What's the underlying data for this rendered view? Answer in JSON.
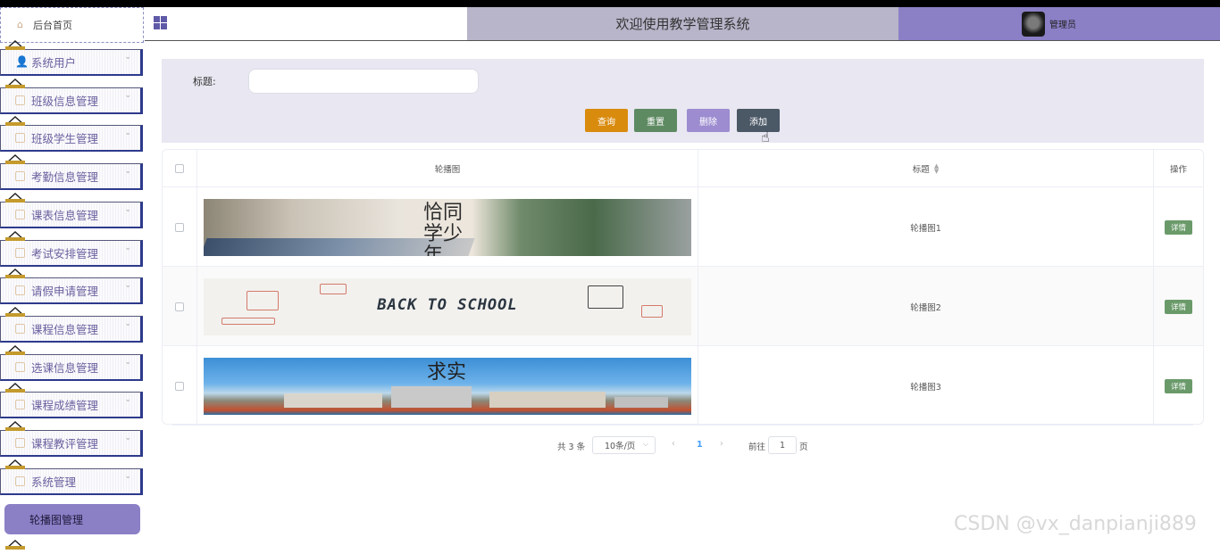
{
  "header": {
    "title": "欢迎使用教学管理系统",
    "user": "管理员"
  },
  "sidebar": {
    "home": "后台首页",
    "items": [
      {
        "label": "系统用户"
      },
      {
        "label": "班级信息管理"
      },
      {
        "label": "班级学生管理"
      },
      {
        "label": "考勤信息管理"
      },
      {
        "label": "课表信息管理"
      },
      {
        "label": "考试安排管理"
      },
      {
        "label": "请假申请管理"
      },
      {
        "label": "课程信息管理"
      },
      {
        "label": "选课信息管理"
      },
      {
        "label": "课程成绩管理"
      },
      {
        "label": "课程教评管理"
      },
      {
        "label": "系统管理"
      }
    ],
    "active_sub": "轮播图管理"
  },
  "search": {
    "label": "标题:",
    "placeholder": "",
    "buttons": {
      "query": "查询",
      "reset": "重置",
      "delete": "删除",
      "add": "添加"
    }
  },
  "table": {
    "columns": {
      "image": "轮播图",
      "title": "标题",
      "actions": "操作"
    },
    "rows": [
      {
        "title": "轮播图1",
        "detail": "详情",
        "banner_text": "恰同学少年"
      },
      {
        "title": "轮播图2",
        "detail": "详情",
        "banner_text": "BACK TO SCHOOL"
      },
      {
        "title": "轮播图3",
        "detail": "详情",
        "banner_text": "求实"
      }
    ]
  },
  "pagination": {
    "total": "共 3 条",
    "page_size": "10条/页",
    "current_page": "1",
    "goto_label": "前往",
    "goto_value": "1",
    "page_suffix": "页"
  },
  "watermark": "CSDN @vx_danpianji889",
  "colors": {
    "accent": "#8b7fc6",
    "query": "#d98b0e",
    "reset": "#5e8a62",
    "delete": "#9d8cd0",
    "add": "#4b5866",
    "detail": "#6a9a6a"
  }
}
